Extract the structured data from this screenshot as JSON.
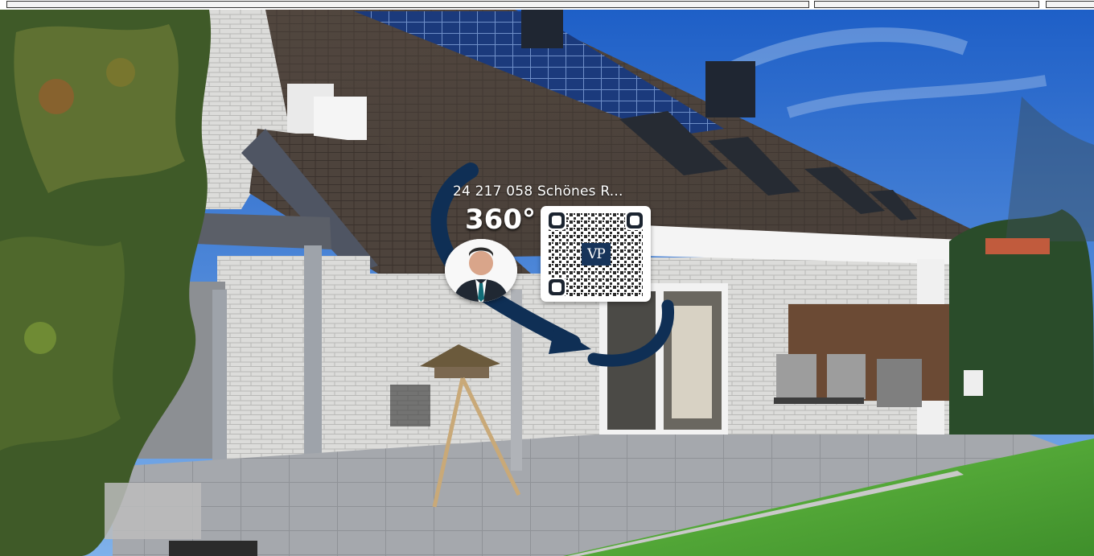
{
  "overlay": {
    "title": "24 217 058 Schönes R...",
    "badge_360": "360°"
  },
  "logo": {
    "text": "VP"
  },
  "colors": {
    "arrow": "#0f2f55",
    "sky": "#2d6fd0",
    "lawn": "#58b13a",
    "logo_bg": "#17345a"
  },
  "icons": {
    "arrow": "curved-arrow-icon",
    "qr": "qr-code-icon"
  }
}
